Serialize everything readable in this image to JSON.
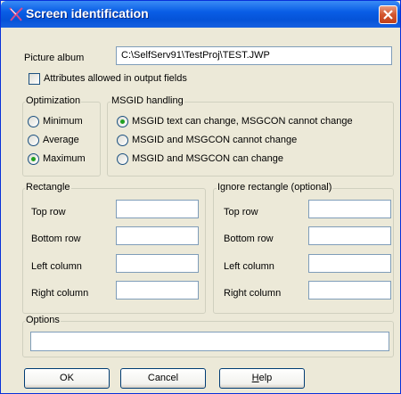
{
  "window": {
    "title": "Screen identification"
  },
  "picture_album": {
    "label": "Picture album",
    "value": "C:\\SelfServ91\\TestProj\\TEST.JWP"
  },
  "attributes": {
    "label": "Attributes allowed in output fields",
    "checked": false
  },
  "optimization": {
    "legend": "Optimization",
    "options": [
      {
        "label": "Minimum",
        "selected": false
      },
      {
        "label": "Average",
        "selected": false
      },
      {
        "label": "Maximum",
        "selected": true
      }
    ]
  },
  "msgid": {
    "legend": "MSGID handling",
    "options": [
      {
        "label": "MSGID text can change, MSGCON cannot change",
        "selected": true
      },
      {
        "label": "MSGID and MSGCON cannot change",
        "selected": false
      },
      {
        "label": "MSGID and MSGCON can change",
        "selected": false
      }
    ]
  },
  "rectangle": {
    "legend": "Rectangle",
    "fields": [
      {
        "label": "Top row",
        "value": ""
      },
      {
        "label": "Bottom row",
        "value": ""
      },
      {
        "label": "Left column",
        "value": ""
      },
      {
        "label": "Right column",
        "value": ""
      }
    ]
  },
  "ignore_rectangle": {
    "legend": "Ignore rectangle (optional)",
    "fields": [
      {
        "label": "Top row",
        "value": ""
      },
      {
        "label": "Bottom row",
        "value": ""
      },
      {
        "label": "Left column",
        "value": ""
      },
      {
        "label": "Right column",
        "value": ""
      }
    ]
  },
  "options": {
    "legend": "Options",
    "value": ""
  },
  "buttons": {
    "ok": "OK",
    "cancel": "Cancel",
    "help_first": "H",
    "help_rest": "elp"
  }
}
